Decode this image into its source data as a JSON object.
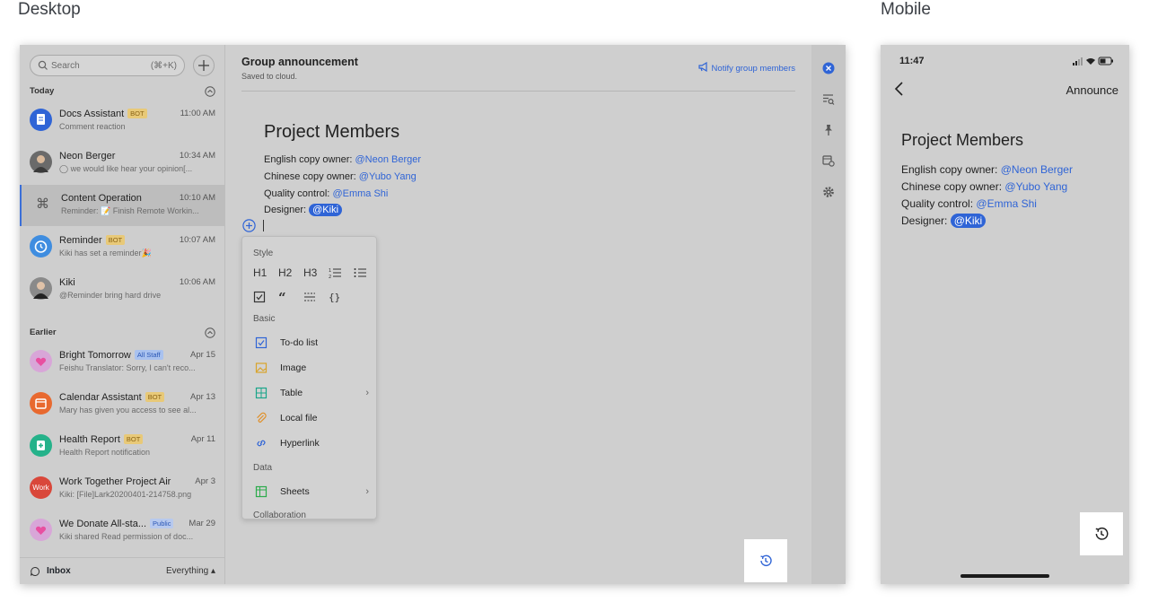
{
  "labels": {
    "desktop": "Desktop",
    "mobile": "Mobile"
  },
  "sidebar": {
    "search_placeholder": "Search",
    "search_shortcut": "(⌘+K)",
    "today_label": "Today",
    "earlier_label": "Earlier",
    "today_chats": [
      {
        "name": "Docs Assistant",
        "badge": "BOT",
        "time": "11:00 AM",
        "sub": "Comment reaction"
      },
      {
        "name": "Neon Berger",
        "badge": "",
        "time": "10:34 AM",
        "sub": "◯ we would like hear your opinion[..."
      },
      {
        "name": "Content Operation",
        "badge": "",
        "time": "10:10 AM",
        "sub": "Reminder: 📝 Finish Remote Workin..."
      },
      {
        "name": "Reminder",
        "badge": "BOT",
        "time": "10:07 AM",
        "sub": "Kiki has set a reminder🎉"
      },
      {
        "name": "Kiki",
        "badge": "",
        "time": "10:06 AM",
        "sub": "@Reminder bring hard drive"
      }
    ],
    "earlier_chats": [
      {
        "name": "Bright Tomorrow",
        "badge": "All Staff",
        "time": "Apr 15",
        "sub": "Feishu Translator: Sorry, I can't reco..."
      },
      {
        "name": "Calendar Assistant",
        "badge": "BOT",
        "time": "Apr 13",
        "sub": "Mary has given you access to see al..."
      },
      {
        "name": "Health Report",
        "badge": "BOT",
        "time": "Apr 11",
        "sub": "Health Report notification"
      },
      {
        "name": "Work Together Project Air",
        "badge": "",
        "time": "Apr 3",
        "sub": "Kiki: [File]Lark20200401-214758.png",
        "avatar_text": "Work"
      },
      {
        "name": "We Donate All-sta...",
        "badge": "Public",
        "time": "Mar 29",
        "sub": "Kiki shared Read permission of doc..."
      }
    ],
    "inbox_label": "Inbox",
    "filter_label": "Everything ▴"
  },
  "editor": {
    "title": "Group announcement",
    "saved": "Saved to cloud.",
    "notify": "Notify group members",
    "doc_heading": "Project Members",
    "lines": [
      {
        "label": "English copy owner:",
        "mention": "@Neon Berger"
      },
      {
        "label": "Chinese copy owner:",
        "mention": "@Yubo Yang"
      },
      {
        "label": "Quality control:",
        "mention": "@Emma Shi"
      },
      {
        "label": "Designer:",
        "mention": "@Kiki"
      }
    ]
  },
  "menu": {
    "style_label": "Style",
    "style_row1": [
      "H1",
      "H2",
      "H3"
    ],
    "basic_label": "Basic",
    "basic_items": [
      "To-do list",
      "Image",
      "Table",
      "Local file",
      "Hyperlink"
    ],
    "data_label": "Data",
    "data_items": [
      "Sheets"
    ],
    "collab_label": "Collaboration"
  },
  "mobile": {
    "time": "11:47",
    "title": "Announce",
    "doc_heading": "Project Members",
    "lines": [
      {
        "label": "English copy owner:",
        "mention": "@Neon Berger"
      },
      {
        "label": "Chinese copy owner:",
        "mention": "@Yubo Yang"
      },
      {
        "label": "Quality control:",
        "mention": "@Emma Shi"
      },
      {
        "label": "Designer:",
        "mention": "@Kiki"
      }
    ]
  },
  "colors": {
    "accent": "#2f64d6",
    "bot_badge": "#e8c978"
  }
}
